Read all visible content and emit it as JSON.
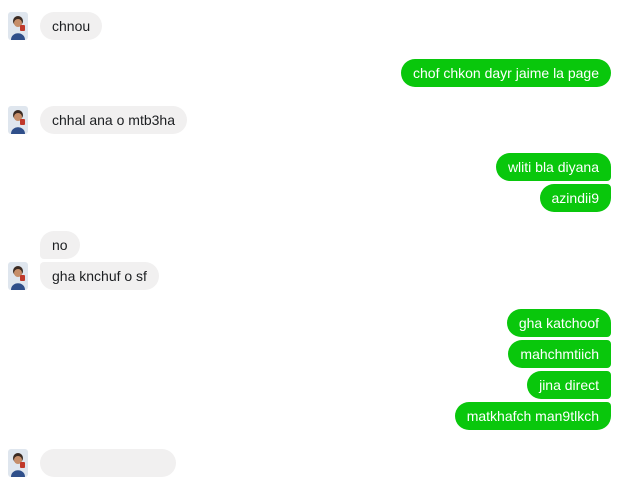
{
  "chat": {
    "messages": [
      {
        "text": "chnou",
        "side": "in",
        "avatar": true
      },
      {
        "text": "chof chkon dayr jaime la page",
        "side": "out"
      },
      {
        "text": "chhal ana o mtb3ha",
        "side": "in",
        "avatar": true
      },
      {
        "text": "wliti bla diyana",
        "side": "out"
      },
      {
        "text": "azindii9",
        "side": "out"
      },
      {
        "text": "no",
        "side": "in"
      },
      {
        "text": "gha knchuf o sf",
        "side": "in",
        "avatar": true
      },
      {
        "text": "gha katchoof",
        "side": "out"
      },
      {
        "text": "mahchmtiich",
        "side": "out"
      },
      {
        "text": "jina direct",
        "side": "out"
      },
      {
        "text": "matkhafch man9tlkch",
        "side": "out"
      },
      {
        "text": "",
        "side": "in",
        "avatar": true
      }
    ]
  },
  "colors": {
    "outgoing_bubble": "#09c70c",
    "incoming_bubble": "#f1f0f0"
  },
  "icons": {
    "avatar": "profile-photo-icon"
  }
}
